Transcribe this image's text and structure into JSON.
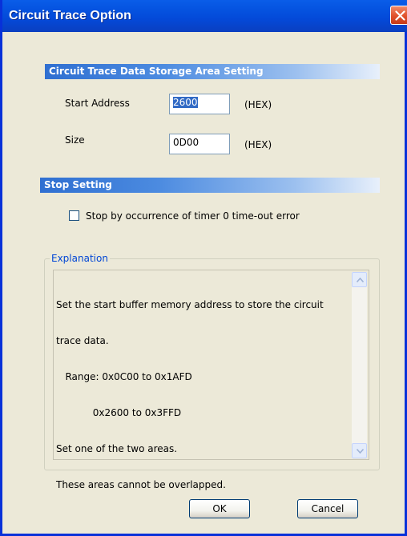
{
  "window": {
    "title": "Circuit Trace Option"
  },
  "storage_section": {
    "header": "Circuit Trace Data Storage Area Setting",
    "start_address": {
      "label": "Start Address",
      "value": "2600",
      "unit": "(HEX)"
    },
    "size": {
      "label": "Size",
      "value": "0D00",
      "unit": "(HEX)"
    }
  },
  "stop_section": {
    "header": "Stop Setting",
    "checkbox": {
      "label": "Stop by occurrence of timer 0 time-out error",
      "checked": false
    }
  },
  "explanation": {
    "legend": "Explanation",
    "lines": [
      "Set the start buffer memory address to store the circuit",
      "trace data.",
      "   Range: 0x0C00 to 0x1AFD",
      "            0x2600 to 0x3FFD",
      "Set one of the two areas.",
      "These areas cannot be overlapped."
    ]
  },
  "buttons": {
    "ok": "OK",
    "cancel": "Cancel"
  },
  "icons": {
    "close": "close-icon",
    "scroll_up": "arrow-up-icon",
    "scroll_down": "arrow-down-icon"
  },
  "colors": {
    "title_bar": "#0553e0",
    "section_header": "#2f6fd1",
    "dialog_bg": "#ece9d8",
    "legend_text": "#0046d5"
  }
}
